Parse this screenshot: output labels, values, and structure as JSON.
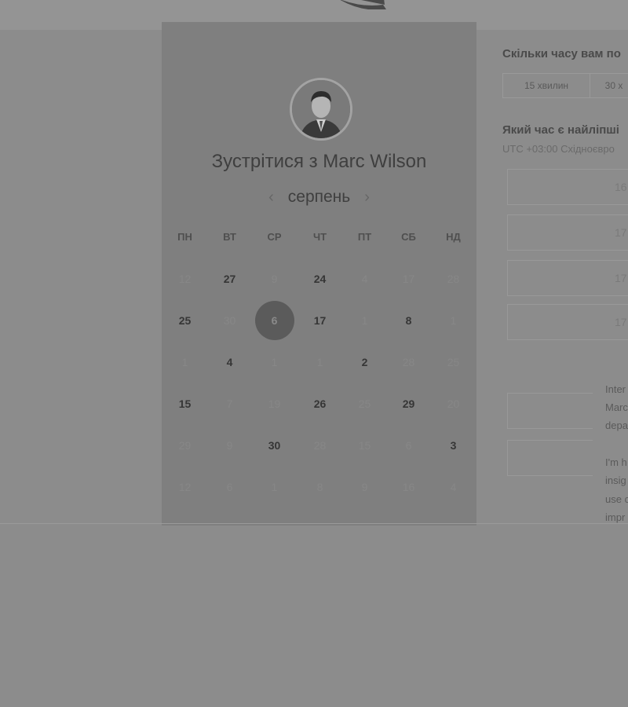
{
  "card": {
    "title": "Зустрітися з Marc Wilson",
    "month": "серпень",
    "prev_arrow": "‹",
    "next_arrow": "›"
  },
  "weekdays": [
    "ПН",
    "ВТ",
    "СР",
    "ЧТ",
    "ПТ",
    "СБ",
    "НД"
  ],
  "calendar_rows": [
    [
      "12",
      "27",
      "9",
      "24",
      "4",
      "17",
      "28"
    ],
    [
      "25",
      "30",
      "6",
      "17",
      "1",
      "8",
      "1"
    ],
    [
      "1",
      "4",
      "1",
      "1",
      "2",
      "28",
      "25"
    ],
    [
      "15",
      "7",
      "19",
      "26",
      "25",
      "29",
      "20"
    ],
    [
      "29",
      "9",
      "30",
      "28",
      "15",
      "6",
      "3"
    ],
    [
      "12",
      "6",
      "1",
      "8",
      "9",
      "16",
      "4"
    ]
  ],
  "selected_day": "6",
  "right": {
    "duration_question": "Скільки часу вам по",
    "durations": [
      "15 хвилин",
      "30 х"
    ],
    "time_question": "Який час є найліпші",
    "timezone": "UTC +03:00 Східноєвро",
    "slots": [
      "16",
      "17",
      "17",
      "17"
    ],
    "bio_lines": [
      "Inter",
      "Marc",
      "depa",
      "I'm h",
      "insig",
      "use c",
      "impr",
      "prod"
    ]
  },
  "colors": {
    "background": "#8c8c8c",
    "card": "#7f7f7f",
    "selected": "#5b5b5b"
  }
}
